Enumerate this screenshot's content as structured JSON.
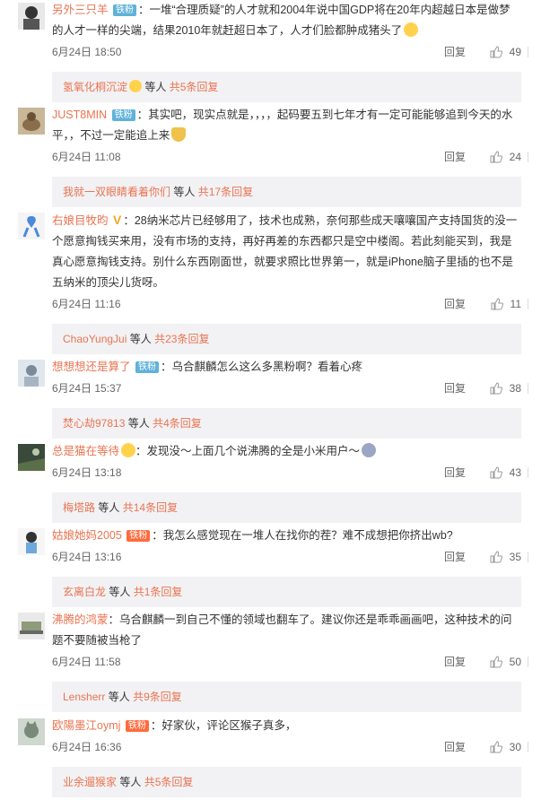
{
  "reply_label": "回复",
  "comments": [
    {
      "user": "另外三只羊",
      "badge": "铁粉",
      "text_html": "：一堆“合理质疑”的人才就和2004年说中国GDP将在20年内超越日本是做梦的人才一样的尖端，结果2010年就赶超日本了，人才们脸都肿成猪头了",
      "time": "6月24日 18:50",
      "likes": "49",
      "reply": {
        "name": "氢氧化桐沉淀",
        "mid": "等人",
        "more": "共5条回复"
      }
    },
    {
      "user": "JUST8MIN",
      "badge": "铁粉",
      "text_html": "：其实吧，现实点就是，，，，起码要五到七年才有一定可能能够追到今天的水平，，不过一定能追上来",
      "time": "6月24日 11:08",
      "likes": "24",
      "reply": {
        "name": "我就一双眼睛看着你们",
        "mid": "等人",
        "more": "共17条回复"
      }
    },
    {
      "user": "右娘目牧昀",
      "text_html": "：28纳米芯片已经够用了，技术也成熟，奈何那些成天嚷嚷国产支持国货的没一个愿意掏钱买来用，没有市场的支持，再好再差的东西都只是空中楼阁。若此刻能买到，我是真心愿意掏钱支持。别什么东西刚面世，就要求照比世界第一，就是iPhone脑子里插的也不是五纳米的顶尖儿货呀。",
      "time": "6月24日 11:16",
      "likes": "11",
      "reply": {
        "name": "ChaoYungJui",
        "mid": "等人",
        "more": "共23条回复"
      }
    },
    {
      "user": "想想想还是算了",
      "badge": "铁粉",
      "text_html": "：乌合麒麟怎么这么多黑粉啊？看着心疼",
      "time": "6月24日 15:37",
      "likes": "38",
      "reply": {
        "name": "焚心劫97813",
        "mid": "等人",
        "more": "共4条回复"
      }
    },
    {
      "user": "总是猫在等待",
      "text_html": "：发现没～上面几个说沸腾的全是小米用户～",
      "time": "6月24日 13:18",
      "likes": "43",
      "reply": {
        "name": "梅塔路",
        "mid": "等人",
        "more": "共14条回复"
      }
    },
    {
      "user": "姑娘她妈2005",
      "badge": "铁粉",
      "text_html": "：我怎么感觉现在一堆人在找你的茬？难不成想把你挤出wb?",
      "time": "6月24日 13:16",
      "likes": "35",
      "reply": {
        "name": "玄离白龙",
        "mid": "等人",
        "more": "共1条回复"
      }
    },
    {
      "user": "沸腾的鸿蒙",
      "text_html": "：乌合麒麟一到自己不懂的领域也翻车了。建议你还是乖乖画画吧，这种技术的问题不要随被当枪了",
      "time": "6月24日 11:58",
      "likes": "50",
      "reply": {
        "name": "Lensherr",
        "mid": "等人",
        "more": "共9条回复"
      }
    },
    {
      "user": "欧陽墨江oymj",
      "badge": "铁粉",
      "text_html": "：好家伙，评论区猴子真多，",
      "time": "6月24日 16:36",
      "likes": "30",
      "reply": {
        "name": "业余遛猴家",
        "mid": "等人",
        "more": "共5条回复"
      }
    }
  ]
}
